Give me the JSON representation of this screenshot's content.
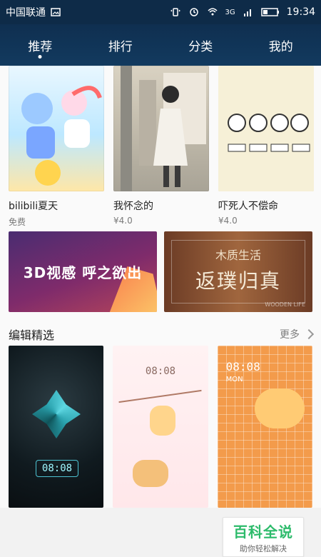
{
  "status_bar": {
    "carrier": "中国联通",
    "time": "19:34",
    "network": "3G",
    "icons": [
      "image-icon",
      "vibrate-icon",
      "alarm-icon",
      "wifi-icon",
      "signal-icon",
      "battery-icon"
    ]
  },
  "nav": {
    "tabs": [
      {
        "label": "推荐",
        "active": true
      },
      {
        "label": "排行",
        "active": false
      },
      {
        "label": "分类",
        "active": false
      },
      {
        "label": "我的",
        "active": false
      }
    ]
  },
  "featured": [
    {
      "title": "bilibili夏天",
      "price": "免费",
      "thumb_style": "anime"
    },
    {
      "title": "我怀念的",
      "price": "¥4.0",
      "thumb_style": "photo"
    },
    {
      "title": "吓死人不偿命",
      "price": "¥4.0",
      "thumb_style": "cartoon"
    }
  ],
  "banners": [
    {
      "text": "3D视感 呼之欲出"
    },
    {
      "line1": "木质生活",
      "line2": "返璞归真",
      "corner": "WOODEN LIFE"
    }
  ],
  "section": {
    "title": "编辑精选",
    "more_label": "更多"
  },
  "editor_picks": [
    {
      "time": "08:08",
      "theme": "dark"
    },
    {
      "time": "08:08",
      "theme": "pink"
    },
    {
      "time": "08:08",
      "theme": "orange",
      "sub": "MON"
    }
  ],
  "watermark": {
    "title": "百科全说",
    "subtitle": "助你轻松解决"
  }
}
